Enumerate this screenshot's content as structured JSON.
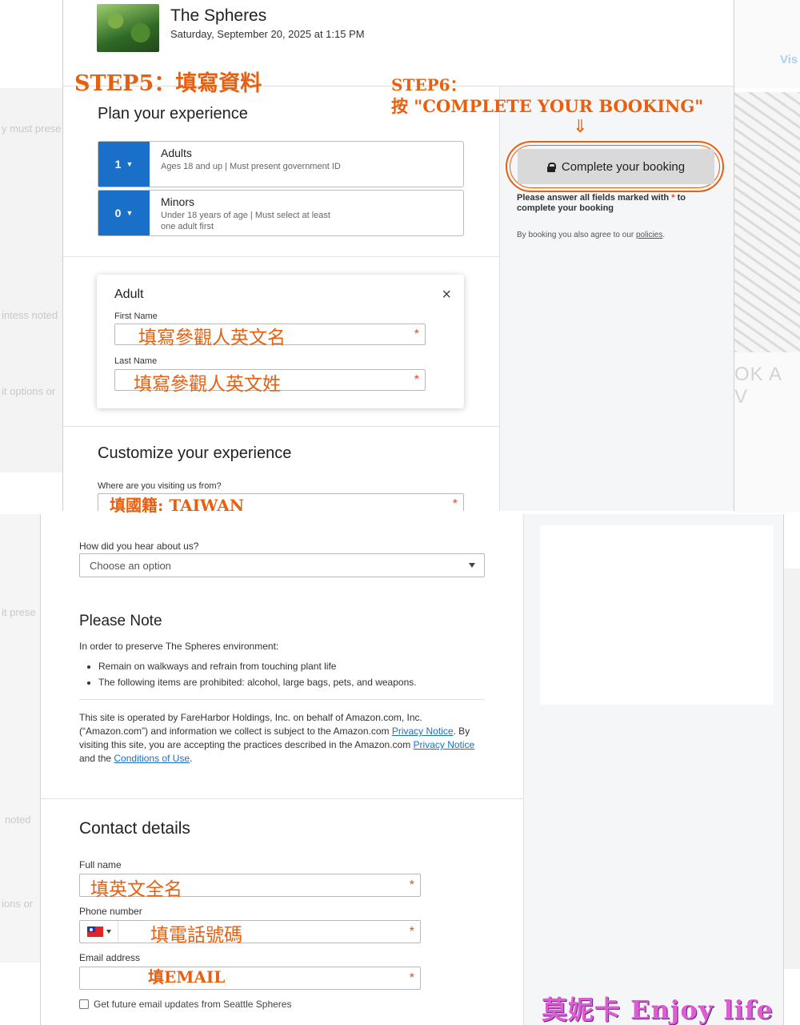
{
  "background": {
    "ghost_texts": [
      "y must prese",
      "intess noted",
      "it options or",
      "it prese",
      "noted",
      "ions or"
    ],
    "visit_link": "Vis",
    "book_text": "OK A V"
  },
  "header": {
    "title": "The Spheres",
    "datetime": "Saturday, September 20, 2025 at 1:15 PM"
  },
  "annotations": {
    "step5": "STEP5：填寫資料",
    "step6_line1": "STEP6：",
    "step6_line2": "按 \"COMPLETE YOUR BOOKING\"",
    "arrow": "⇓",
    "first_name_hint": "填寫參觀人英文名",
    "last_name_hint": "填寫參觀人英文姓",
    "country_hint": "填國籍: TAIWAN",
    "full_name_hint": "填英文全名",
    "phone_hint": "填電話號碼",
    "email_hint": "填EMAIL",
    "watermark": "莫妮卡 Enjoy life"
  },
  "plan": {
    "heading": "Plan your experience",
    "guests": [
      {
        "count": "1",
        "label": "Adults",
        "description": "Ages 18 and up | Must present government ID"
      },
      {
        "count": "0",
        "label": "Minors",
        "description": "Under 18 years of age | Must select at least one adult first"
      }
    ]
  },
  "adult_form": {
    "title": "Adult",
    "close_icon": "×",
    "first_name_label": "First Name",
    "last_name_label": "Last Name",
    "required_mark": "*"
  },
  "customize": {
    "heading": "Customize your experience",
    "visiting_from_label": "Where are you visiting us from?",
    "hear_about_label": "How did you hear about us?",
    "hear_about_placeholder": "Choose an option"
  },
  "sidebar": {
    "complete_button": "Complete your booking",
    "answer_note_prefix": "Please answer all fields marked with",
    "answer_note_suffix": "to complete your booking",
    "agree_prefix": "By booking you also agree to our",
    "policies_link": "policies",
    "agree_suffix": "."
  },
  "please_note": {
    "heading": "Please Note",
    "intro": "In order to preserve The Spheres environment:",
    "items": [
      "Remain on walkways and refrain from touching plant life",
      "The following items are prohibited: alcohol, large bags, pets, and weapons."
    ]
  },
  "legal": {
    "text1": "This site is operated by FareHarbor Holdings, Inc. on behalf of Amazon.com, Inc. (“Amazon.com”) and information we collect is subject to the Amazon.com ",
    "privacy_link1": "Privacy Notice",
    "text2": ". By visiting this site, you are accepting the practices described in the Amazon.com ",
    "privacy_link2": "Privacy Notice",
    "text3": " and the ",
    "conditions_link": "Conditions of Use",
    "text4": "."
  },
  "contact": {
    "heading": "Contact details",
    "full_name_label": "Full name",
    "phone_label": "Phone number",
    "email_label": "Email address",
    "updates_checkbox": "Get future email updates from Seattle Spheres"
  },
  "colors": {
    "accent": "#1a6fc9",
    "required": "#e24b1f",
    "annotation": "#e8600f",
    "watermark": "#e05cd3"
  }
}
